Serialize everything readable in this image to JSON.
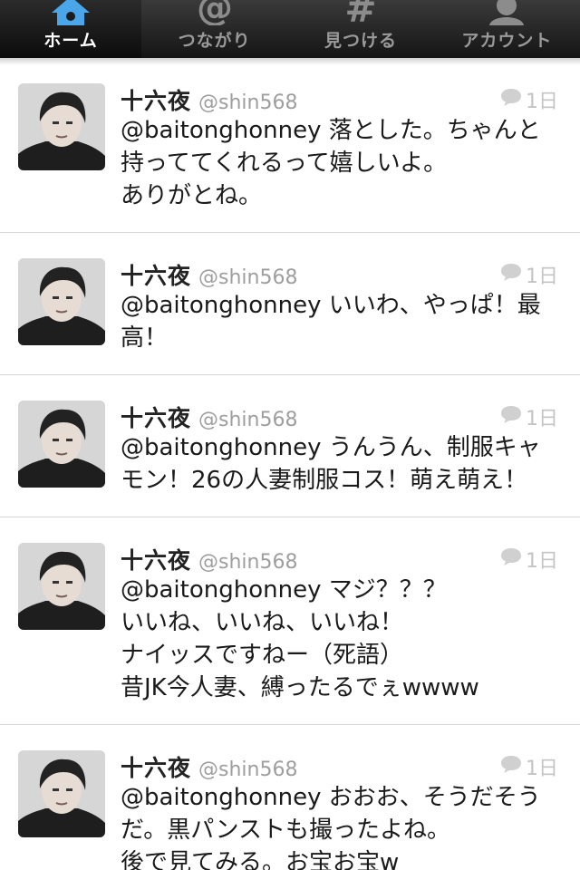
{
  "tabs": [
    {
      "label": "ホーム",
      "icon": "home-icon",
      "active": true
    },
    {
      "label": "つながり",
      "icon": "at-sign-icon",
      "active": false
    },
    {
      "label": "見つける",
      "icon": "hashtag-icon",
      "active": false
    },
    {
      "label": "アカウント",
      "icon": "person-icon",
      "active": false
    }
  ],
  "colors": {
    "tab_active_icon": "#4aa6e8",
    "tab_inactive": "#8c8c8c",
    "text": "#1a1a1a",
    "muted": "#9e9e9e"
  },
  "tweets": [
    {
      "name": "十六夜",
      "handle": "@shin568",
      "time": "1日",
      "text": "@baitonghonney 落とした。ちゃんと\n持っててくれるって嬉しいよ。\nありがとね。"
    },
    {
      "name": "十六夜",
      "handle": "@shin568",
      "time": "1日",
      "text": "@baitonghonney いいわ、やっぱ！最\n高！"
    },
    {
      "name": "十六夜",
      "handle": "@shin568",
      "time": "1日",
      "text": "@baitonghonney うんうん、制服キャ\nモン！26の人妻制服コス！萌え萌え！"
    },
    {
      "name": "十六夜",
      "handle": "@shin568",
      "time": "1日",
      "text": "@baitonghonney マジ？？？\nいいね、いいね、いいね！\nナイッスですねー（死語）\n昔JK今人妻、縛ったるでぇwwww"
    },
    {
      "name": "十六夜",
      "handle": "@shin568",
      "time": "1日",
      "text": "@baitonghonney おおお、そうだそう\nだ。黒パンストも撮ったよね。\n後で見てみる。お宝お宝w"
    }
  ]
}
